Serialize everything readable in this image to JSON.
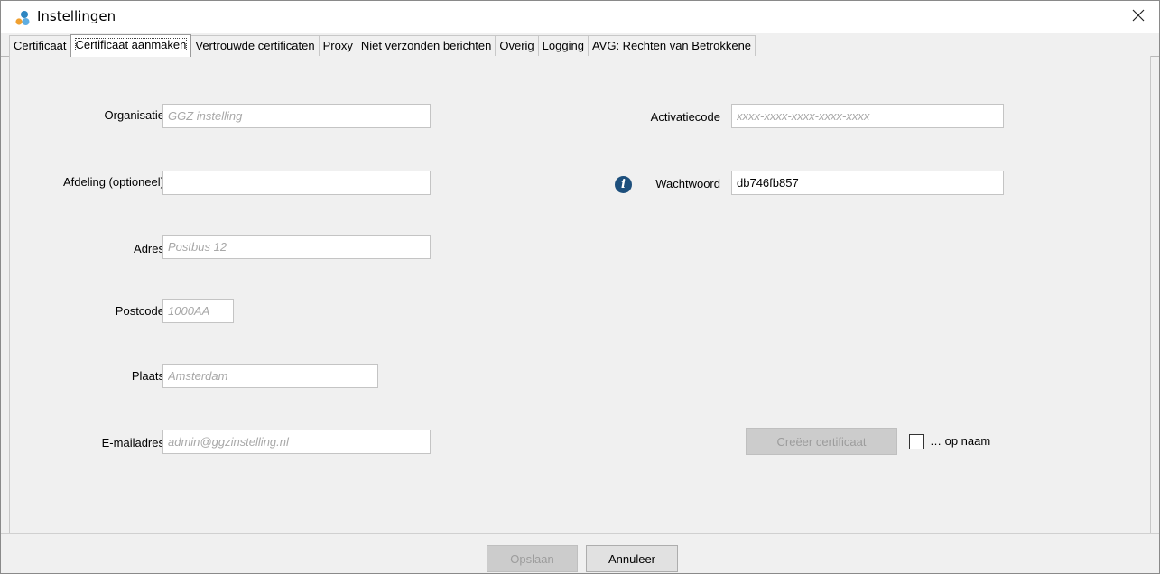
{
  "window": {
    "title": "Instellingen",
    "icon": "app-cluster-icon",
    "accent": "#2e86c1"
  },
  "tabs": [
    {
      "label": "Certificaat",
      "active": false
    },
    {
      "label": "Certificaat aanmaken",
      "active": true
    },
    {
      "label": "Vertrouwde certificaten",
      "active": false
    },
    {
      "label": "Proxy",
      "active": false
    },
    {
      "label": "Niet verzonden berichten",
      "active": false
    },
    {
      "label": "Overig",
      "active": false
    },
    {
      "label": "Logging",
      "active": false
    },
    {
      "label": "AVG: Rechten van Betrokkene",
      "active": false
    }
  ],
  "form": {
    "organisatie": {
      "label": "Organisatie",
      "value": "",
      "placeholder": "GGZ instelling"
    },
    "afdeling": {
      "label": "Afdeling (optioneel)",
      "value": "",
      "placeholder": ""
    },
    "adres": {
      "label": "Adres",
      "value": "",
      "placeholder": "Postbus 12"
    },
    "postcode": {
      "label": "Postcode",
      "value": "",
      "placeholder": "1000AA"
    },
    "plaats": {
      "label": "Plaats",
      "value": "",
      "placeholder": "Amsterdam"
    },
    "email": {
      "label": "E-mailadres",
      "value": "",
      "placeholder": "admin@ggzinstelling.nl"
    },
    "activatiecode": {
      "label": "Activatiecode",
      "value": "",
      "placeholder": "xxxx-xxxx-xxxx-xxxx-xxxx"
    },
    "wachtwoord": {
      "label": "Wachtwoord",
      "value": "db746fb857",
      "placeholder": ""
    }
  },
  "actions": {
    "create_certificate": "Creëer certificaat",
    "on_name_label": "… op naam",
    "on_name_checked": false,
    "save": "Opslaan",
    "cancel": "Annuleer"
  },
  "colors": {
    "info_icon": "#1d4f7c"
  }
}
